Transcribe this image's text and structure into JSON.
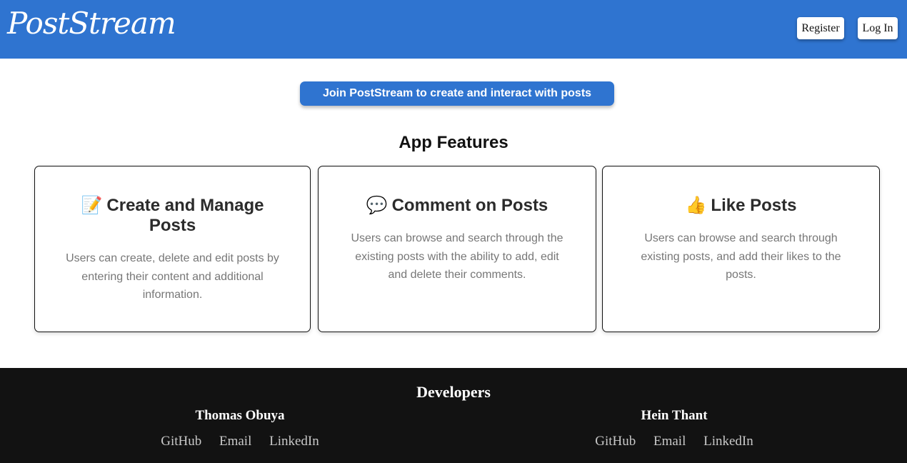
{
  "header": {
    "logo": "PostStream",
    "register_label": "Register",
    "login_label": "Log In"
  },
  "cta": {
    "label": "Join PostStream to create and interact with posts"
  },
  "features": {
    "title": "App Features",
    "cards": [
      {
        "emoji": "📝",
        "icon": "memo-icon",
        "title": "Create and Manage Posts",
        "description": "Users can create, delete and edit posts by entering their content and additional information."
      },
      {
        "emoji": "💬",
        "icon": "speech-bubble-icon",
        "title": "Comment on Posts",
        "description": "Users can browse and search through the existing posts with the ability to add, edit and delete their comments."
      },
      {
        "emoji": "👍",
        "icon": "thumbs-up-icon",
        "title": "Like Posts",
        "description": "Users can browse and search through existing posts, and add their likes to the posts."
      }
    ]
  },
  "footer": {
    "title": "Developers",
    "developers": [
      {
        "name": "Thomas Obuya",
        "links": [
          "GitHub",
          "Email",
          "LinkedIn"
        ]
      },
      {
        "name": "Hein Thant",
        "links": [
          "GitHub",
          "Email",
          "LinkedIn"
        ]
      }
    ]
  },
  "colors": {
    "brand": "#2f74d0",
    "footer_bg": "#121212",
    "description_text": "#777777"
  }
}
